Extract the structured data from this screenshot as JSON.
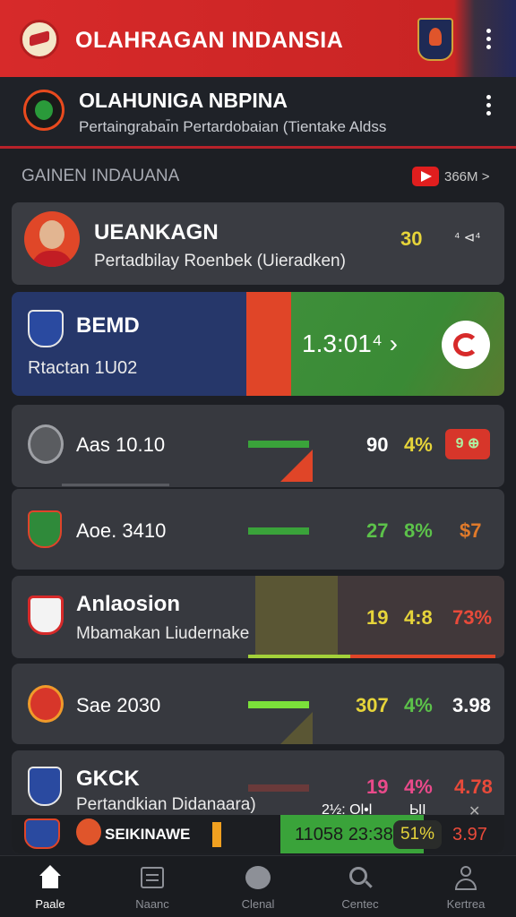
{
  "topbar": {
    "title": "OLAHRAGAN INDANSIA"
  },
  "subheader": {
    "title": "OLAHUNIGA NBPINA",
    "subtitle": "Pertaingrabaı̄n   Pertardobaian (Tientake   Aldss"
  },
  "section": {
    "title": "GAINEN INDAUANA",
    "video_label": "366M >"
  },
  "featured": {
    "name": "UEANKAGN",
    "desc": "Pertadbilay  Roenbek   (Uieradken)",
    "value": "30",
    "extra": "⁴ ⊲⁴"
  },
  "match": {
    "team": "BEMD",
    "sub": "Rtactan 1U02",
    "score": "1.3:01⁴ ›"
  },
  "rows": [
    {
      "label": "Aas 10.10",
      "a": "90",
      "b": "4%",
      "badge": "9 ⊕"
    },
    {
      "label": "Aoe. 3410",
      "a": "27",
      "b": "8%",
      "c": "$7"
    },
    {
      "label": "Anlaosion",
      "sub": "Mbamakan Liudernake",
      "a": "19",
      "b": "4:8",
      "c": "73%"
    },
    {
      "label": "Sae 2030",
      "a": "307",
      "b": "4%",
      "c": "3.98"
    },
    {
      "label": "GKCK",
      "sub": "Pertandkian Didanaara)",
      "a": "19",
      "b": "4%",
      "c": "4.78"
    }
  ],
  "ticker": {
    "brand": "SEIKINAWE",
    "t1": "2½: Ol•l",
    "t2": "ЫI",
    "close": "✕",
    "score": "11058  23:38",
    "pct": "51%",
    "val": "3.97"
  },
  "nav": [
    {
      "label": "Paale"
    },
    {
      "label": "Naanc"
    },
    {
      "label": "Clenal"
    },
    {
      "label": "Centec"
    },
    {
      "label": "Kertrea"
    }
  ],
  "colors": {
    "accent": "#d72a2a",
    "green": "#3aa33a",
    "yellow": "#e6d43a",
    "navy": "#1e3566"
  }
}
